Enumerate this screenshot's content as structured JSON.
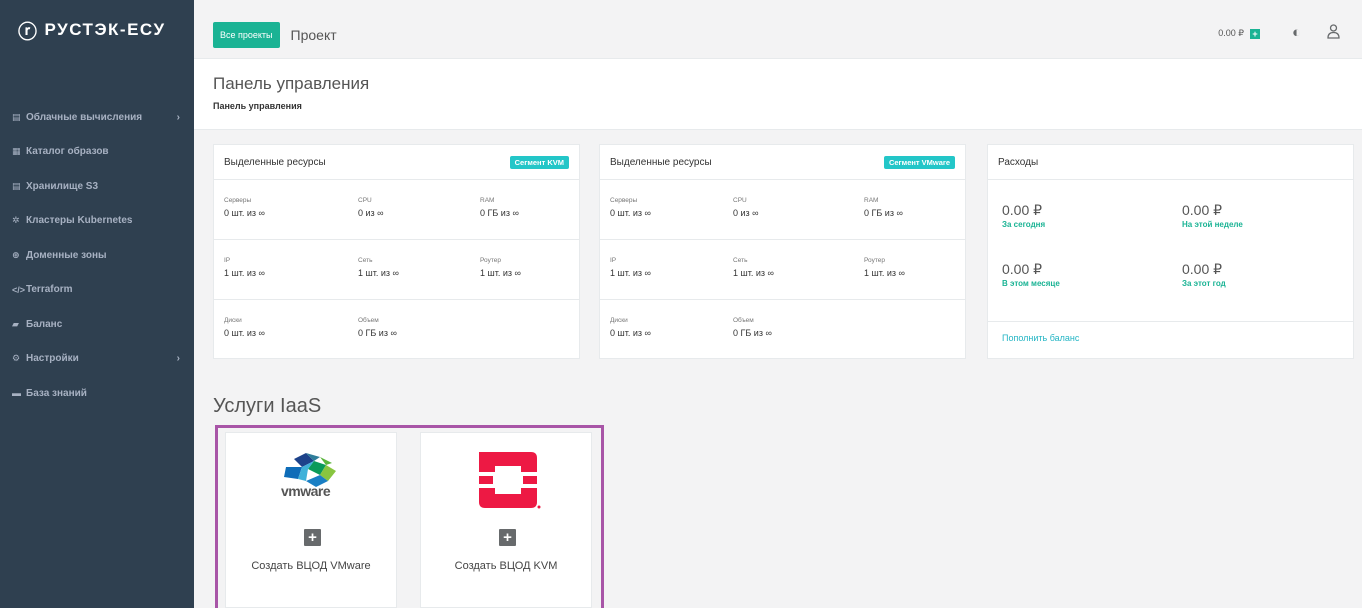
{
  "brand": {
    "name": "РУСТЭК-ЕСУ",
    "accent": "#1ab394"
  },
  "sidebar": {
    "items": [
      {
        "icon": "server-icon",
        "label": "Облачные вычисления",
        "has_chevron": true
      },
      {
        "icon": "grid-icon",
        "label": "Каталог образов"
      },
      {
        "icon": "database-icon",
        "label": "Хранилище S3"
      },
      {
        "icon": "cluster-icon",
        "label": "Кластеры Kubernetes"
      },
      {
        "icon": "globe-icon",
        "label": "Доменные зоны"
      },
      {
        "icon": "code-icon",
        "label": "Terraform"
      },
      {
        "icon": "wallet-icon",
        "label": "Баланс"
      },
      {
        "icon": "cogs-icon",
        "label": "Настройки",
        "has_chevron": true
      },
      {
        "icon": "book-icon",
        "label": "База знаний"
      }
    ]
  },
  "header": {
    "all_projects": "Все проекты",
    "project": "Проект",
    "balance": "0.00 ₽"
  },
  "page": {
    "title": "Панель управления",
    "breadcrumb": "Панель управления"
  },
  "kvm": {
    "title": "Выделенные ресурсы",
    "badge": "Сегмент KVM",
    "rows": [
      [
        {
          "k": "Серверы",
          "v": "0 шт. из ∞"
        },
        {
          "k": "CPU",
          "v": "0  из ∞"
        },
        {
          "k": "RAM",
          "v": "0 ГБ из ∞"
        }
      ],
      [
        {
          "k": "IP",
          "v": "1 шт. из ∞"
        },
        {
          "k": "Сеть",
          "v": "1 шт. из ∞"
        },
        {
          "k": "Роутер",
          "v": "1 шт. из ∞"
        }
      ],
      [
        {
          "k": "Диски",
          "v": "0 шт. из ∞"
        },
        {
          "k": "Объем",
          "v": "0 ГБ из ∞"
        }
      ]
    ]
  },
  "vmware": {
    "title": "Выделенные ресурсы",
    "badge": "Сегмент VMware",
    "rows": [
      [
        {
          "k": "Серверы",
          "v": "0 шт. из ∞"
        },
        {
          "k": "CPU",
          "v": "0  из ∞"
        },
        {
          "k": "RAM",
          "v": "0 ГБ из ∞"
        }
      ],
      [
        {
          "k": "IP",
          "v": "1 шт. из ∞"
        },
        {
          "k": "Сеть",
          "v": "1 шт. из ∞"
        },
        {
          "k": "Роутер",
          "v": "1 шт. из ∞"
        }
      ],
      [
        {
          "k": "Диски",
          "v": "0 шт. из ∞"
        },
        {
          "k": "Объем",
          "v": "0 ГБ из ∞"
        }
      ]
    ]
  },
  "expenses": {
    "title": "Расходы",
    "items": [
      {
        "amount": "0.00 ₽",
        "period": "За сегодня"
      },
      {
        "amount": "0.00 ₽",
        "period": "На этой неделе"
      },
      {
        "amount": "0.00 ₽",
        "period": "В этом месяце"
      },
      {
        "amount": "0.00 ₽",
        "period": "За этот год"
      }
    ],
    "topup": "Пополнить баланс"
  },
  "services": {
    "title": "Услуги IaaS",
    "vmware_logo_text": "vmware",
    "vmware_label": "Создать ВЦОД VMware",
    "kvm_label": "Создать ВЦОД KVM"
  }
}
